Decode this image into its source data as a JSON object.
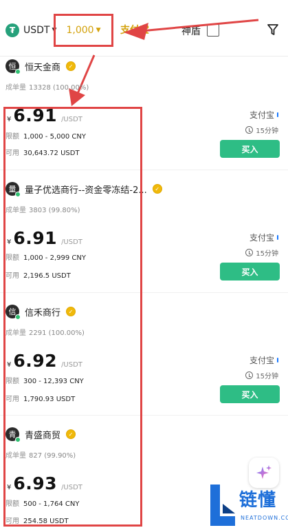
{
  "toolbar": {
    "coin_symbol": "₮",
    "coin_label": "USDT",
    "amount": "1,000",
    "payment": "支付宝",
    "shenzhen_label": "神盾",
    "filter_icon": "funnel-icon",
    "accent_color": "#d3a10a",
    "annotation_color": "#e04545"
  },
  "listings": [
    {
      "avatar_char": "恒",
      "name": "恒天金商",
      "stats_label": "成单量",
      "stats_value": "13328 (100.00%)",
      "currency_symbol": "¥",
      "price": "6.91",
      "price_unit": "/USDT",
      "limit_label": "限额",
      "limit_value": "1,000 - 5,000 CNY",
      "available_label": "可用",
      "available_value": "30,643.72 USDT",
      "pay_method": "支付宝",
      "time_limit": "15分钟",
      "buy_label": "买入"
    },
    {
      "avatar_char": "量",
      "name": "量子优选商行--资金零冻结-2...",
      "stats_label": "成单量",
      "stats_value": "3803 (99.80%)",
      "currency_symbol": "¥",
      "price": "6.91",
      "price_unit": "/USDT",
      "limit_label": "限额",
      "limit_value": "1,000 - 2,999 CNY",
      "available_label": "可用",
      "available_value": "2,196.5 USDT",
      "pay_method": "支付宝",
      "time_limit": "15分钟",
      "buy_label": "买入"
    },
    {
      "avatar_char": "信",
      "name": "信禾商行",
      "stats_label": "成单量",
      "stats_value": "2291 (100.00%)",
      "currency_symbol": "¥",
      "price": "6.92",
      "price_unit": "/USDT",
      "limit_label": "限额",
      "limit_value": "300 - 12,393 CNY",
      "available_label": "可用",
      "available_value": "1,790.93 USDT",
      "pay_method": "支付宝",
      "time_limit": "15分钟",
      "buy_label": "买入"
    },
    {
      "avatar_char": "青",
      "name": "青盛商贸",
      "stats_label": "成单量",
      "stats_value": "827 (99.90%)",
      "currency_symbol": "¥",
      "price": "6.93",
      "price_unit": "/USDT",
      "limit_label": "限额",
      "limit_value": "500 - 1,764 CNY",
      "available_label": "可用",
      "available_value": "254.58 USDT"
    }
  ],
  "watermark": {
    "title": "链懂",
    "subtitle": "NEATDOWN.COM",
    "color": "#1e6fd9"
  },
  "buy_button_color": "#2ebd85"
}
